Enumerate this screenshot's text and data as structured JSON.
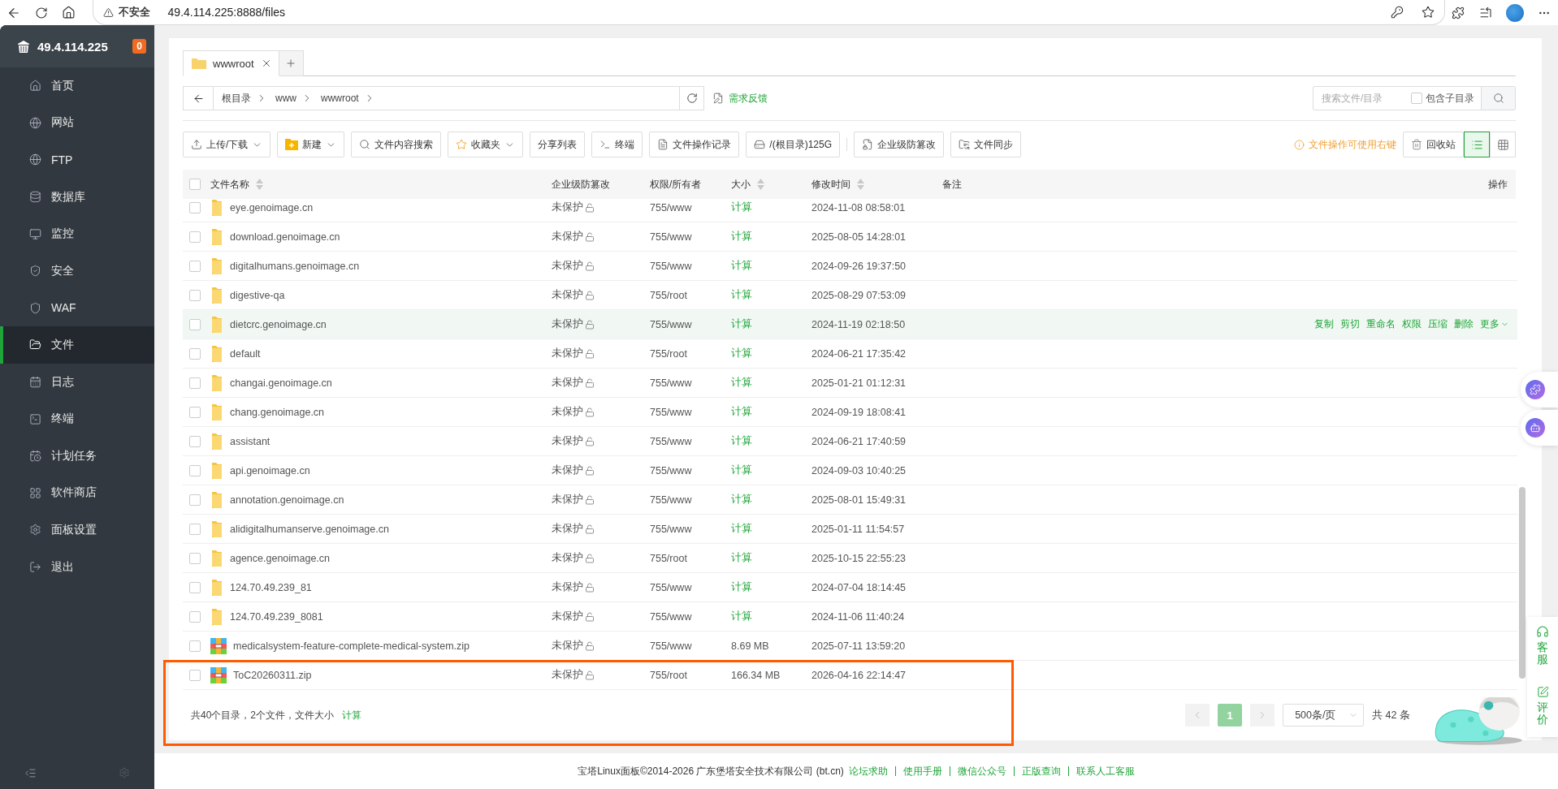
{
  "browser": {
    "security": "不安全",
    "url": "49.4.114.225:8888/files"
  },
  "sidebar": {
    "server": "49.4.114.225",
    "badge": "0",
    "items": [
      {
        "label": "首页",
        "selected": false
      },
      {
        "label": "网站",
        "selected": false
      },
      {
        "label": "FTP",
        "selected": false
      },
      {
        "label": "数据库",
        "selected": false
      },
      {
        "label": "监控",
        "selected": false
      },
      {
        "label": "安全",
        "selected": false
      },
      {
        "label": "WAF",
        "selected": false
      },
      {
        "label": "文件",
        "selected": true
      },
      {
        "label": "日志",
        "selected": false
      },
      {
        "label": "终端",
        "selected": false
      },
      {
        "label": "计划任务",
        "selected": false
      },
      {
        "label": "软件商店",
        "selected": false
      },
      {
        "label": "面板设置",
        "selected": false
      },
      {
        "label": "退出",
        "selected": false
      }
    ]
  },
  "tabs": [
    {
      "label": "wwwroot",
      "selected": true
    }
  ],
  "breadcrumb": [
    "根目录",
    "www",
    "wwwroot"
  ],
  "feedback": "需求反馈",
  "search": {
    "placeholder": "搜索文件/目录",
    "subdir_label": "包含子目录",
    "subdir_checked": false
  },
  "toolbar": [
    {
      "label": "上传/下载",
      "dropdown": true
    },
    {
      "label": "新建",
      "dropdown": true
    },
    {
      "label": "文件内容搜索",
      "dropdown": false
    },
    {
      "label": "收藏夹",
      "dropdown": true
    },
    {
      "label": "分享列表",
      "dropdown": false
    },
    {
      "label": "终端",
      "dropdown": false
    },
    {
      "label": "文件操作记录",
      "dropdown": false
    },
    {
      "label": "/(根目录)125G",
      "dropdown": false
    },
    {
      "label": "企业级防篡改",
      "dropdown": false
    },
    {
      "label": "文件同步",
      "dropdown": false
    }
  ],
  "hint": "文件操作可使用右键",
  "recycle": "回收站",
  "select_all_checked": false,
  "view_modes": [
    {
      "selected": true
    },
    {
      "selected": false
    }
  ],
  "columns": [
    {
      "label": "文件名称",
      "sortable": true
    },
    {
      "label": "企业级防篡改",
      "sortable": false
    },
    {
      "label": "权限/所有者",
      "sortable": false
    },
    {
      "label": "大小",
      "sortable": true
    },
    {
      "label": "修改时间",
      "sortable": true
    },
    {
      "label": "备注",
      "sortable": false
    },
    {
      "label": "操作",
      "sortable": false
    }
  ],
  "rows": [
    {
      "kind": "folder",
      "name": "eye.genoimage.cn",
      "protect": "未保护",
      "perm": "755/www",
      "size": "计算",
      "mtime": "2024-11-08 08:58:01",
      "checked": false,
      "hovered": false
    },
    {
      "kind": "folder",
      "name": "download.genoimage.cn",
      "protect": "未保护",
      "perm": "755/www",
      "size": "计算",
      "mtime": "2025-08-05 14:28:01",
      "checked": false,
      "hovered": false
    },
    {
      "kind": "folder",
      "name": "digitalhumans.genoimage.cn",
      "protect": "未保护",
      "perm": "755/www",
      "size": "计算",
      "mtime": "2024-09-26 19:37:50",
      "checked": false,
      "hovered": false
    },
    {
      "kind": "folder",
      "name": "digestive-qa",
      "protect": "未保护",
      "perm": "755/root",
      "size": "计算",
      "mtime": "2025-08-29 07:53:09",
      "checked": false,
      "hovered": false
    },
    {
      "kind": "folder",
      "name": "dietcrc.genoimage.cn",
      "protect": "未保护",
      "perm": "755/www",
      "size": "计算",
      "mtime": "2024-11-19 02:18:50",
      "checked": false,
      "hovered": true,
      "actions": [
        "复制",
        "剪切",
        "重命名",
        "权限",
        "压缩",
        "删除",
        "更多"
      ]
    },
    {
      "kind": "folder",
      "name": "default",
      "protect": "未保护",
      "perm": "755/root",
      "size": "计算",
      "mtime": "2024-06-21 17:35:42",
      "checked": false,
      "hovered": false
    },
    {
      "kind": "folder",
      "name": "changai.genoimage.cn",
      "protect": "未保护",
      "perm": "755/www",
      "size": "计算",
      "mtime": "2025-01-21 01:12:31",
      "checked": false,
      "hovered": false
    },
    {
      "kind": "folder",
      "name": "chang.genoimage.cn",
      "protect": "未保护",
      "perm": "755/www",
      "size": "计算",
      "mtime": "2024-09-19 18:08:41",
      "checked": false,
      "hovered": false
    },
    {
      "kind": "folder",
      "name": "assistant",
      "protect": "未保护",
      "perm": "755/www",
      "size": "计算",
      "mtime": "2024-06-21 17:40:59",
      "checked": false,
      "hovered": false
    },
    {
      "kind": "folder",
      "name": "api.genoimage.cn",
      "protect": "未保护",
      "perm": "755/www",
      "size": "计算",
      "mtime": "2024-09-03 10:40:25",
      "checked": false,
      "hovered": false
    },
    {
      "kind": "folder",
      "name": "annotation.genoimage.cn",
      "protect": "未保护",
      "perm": "755/www",
      "size": "计算",
      "mtime": "2025-08-01 15:49:31",
      "checked": false,
      "hovered": false
    },
    {
      "kind": "folder",
      "name": "alidigitalhumanserve.genoimage.cn",
      "protect": "未保护",
      "perm": "755/www",
      "size": "计算",
      "mtime": "2025-01-11 11:54:57",
      "checked": false,
      "hovered": false
    },
    {
      "kind": "folder",
      "name": "agence.genoimage.cn",
      "protect": "未保护",
      "perm": "755/root",
      "size": "计算",
      "mtime": "2025-10-15 22:55:23",
      "checked": false,
      "hovered": false
    },
    {
      "kind": "folder",
      "name": "124.70.49.239_81",
      "protect": "未保护",
      "perm": "755/www",
      "size": "计算",
      "mtime": "2024-07-04 18:14:45",
      "checked": false,
      "hovered": false
    },
    {
      "kind": "folder",
      "name": "124.70.49.239_8081",
      "protect": "未保护",
      "perm": "755/www",
      "size": "计算",
      "mtime": "2024-11-06 11:40:24",
      "checked": false,
      "hovered": false
    },
    {
      "kind": "zip",
      "name": "medicalsystem-feature-complete-medical-system.zip",
      "protect": "未保护",
      "perm": "755/www",
      "size": "8.69 MB",
      "mtime": "2025-07-11 13:59:20",
      "checked": false,
      "hovered": false
    },
    {
      "kind": "zip",
      "name": "ToC20260311.zip",
      "protect": "未保护",
      "perm": "755/root",
      "size": "166.34 MB",
      "mtime": "2026-04-16 22:14:47",
      "checked": false,
      "hovered": false
    }
  ],
  "summary": {
    "text": "共40个目录，2个文件，文件大小",
    "link": "计算"
  },
  "pagination": {
    "pages": [
      {
        "label": "1",
        "selected": true
      }
    ],
    "page_size": "500条/页",
    "total": "共 42 条"
  },
  "footer": {
    "copyright": "宝塔Linux面板©2014-2026 广东堡塔安全技术有限公司 (bt.cn)",
    "links": [
      "论坛求助",
      "使用手册",
      "微信公众号",
      "正版查询",
      "联系人工客服"
    ]
  },
  "service": {
    "support": "客服",
    "review": "评价"
  }
}
